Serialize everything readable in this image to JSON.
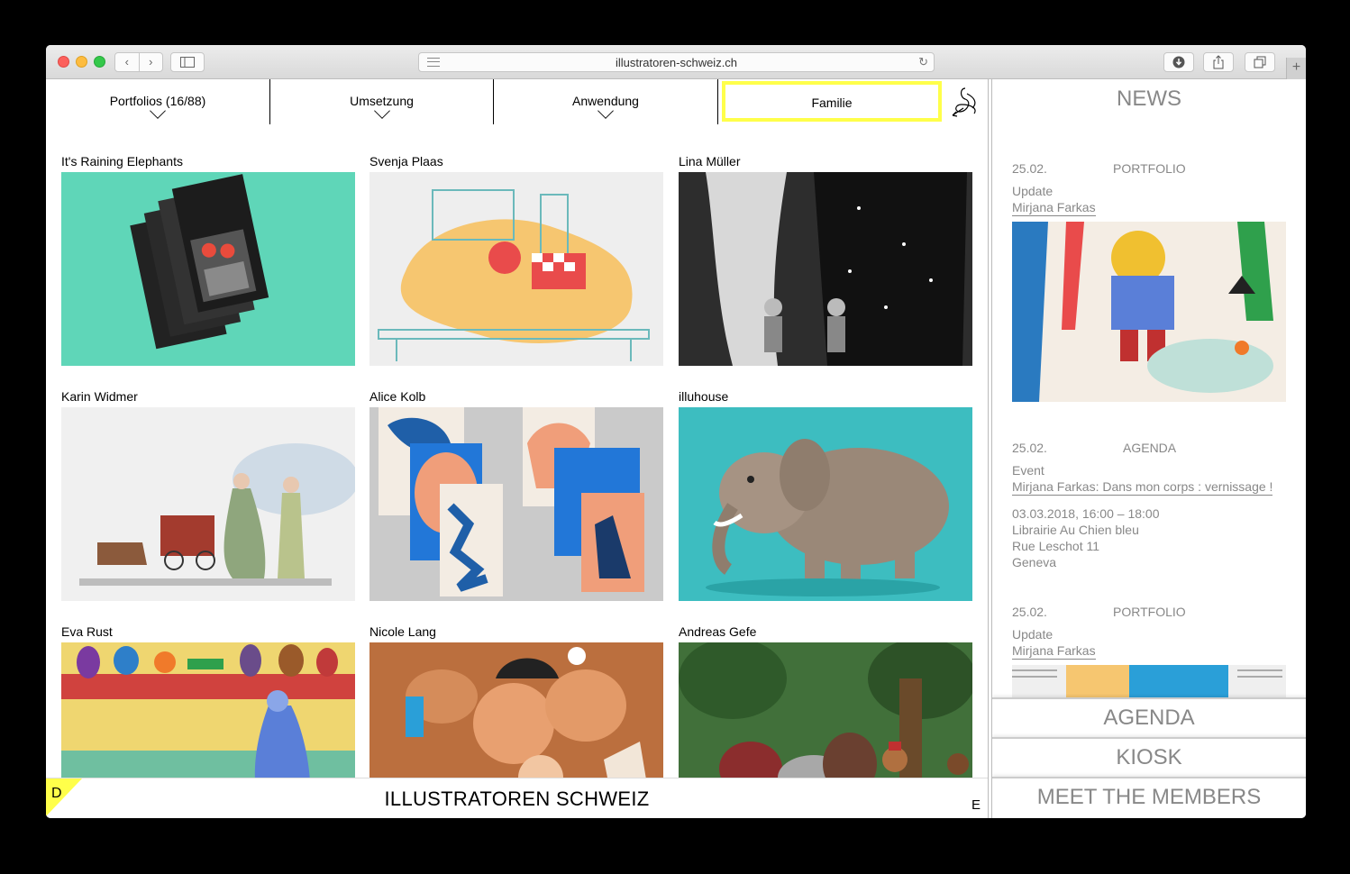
{
  "browser": {
    "url": "illustratoren-schweiz.ch",
    "back": "‹",
    "forward": "›",
    "reload": "↻",
    "newtab": "+"
  },
  "filters": {
    "portfolios": "Portfolios (16/88)",
    "umsetzung": "Umsetzung",
    "anwendung": "Anwendung",
    "familie": "Familie"
  },
  "grid": [
    {
      "name": "It's Raining Elephants"
    },
    {
      "name": "Svenja Plaas"
    },
    {
      "name": "Lina Müller"
    },
    {
      "name": "Karin Widmer"
    },
    {
      "name": "Alice Kolb"
    },
    {
      "name": "illuhouse"
    },
    {
      "name": "Eva Rust"
    },
    {
      "name": "Nicole Lang"
    },
    {
      "name": "Andreas Gefe"
    }
  ],
  "bottom": {
    "lang_d": "D",
    "title": "ILLUSTRATOREN SCHWEIZ",
    "lang_e": "E"
  },
  "news": {
    "heading": "NEWS",
    "entries": [
      {
        "date": "25.02.",
        "category": "PORTFOLIO",
        "kind": "Update",
        "link": "Mirjana Farkas"
      },
      {
        "date": "25.02.",
        "category": "AGENDA",
        "kind": "Event",
        "link": "Mirjana Farkas: Dans mon corps : vernissage !",
        "details": [
          "03.03.2018, 16:00 – 18:00",
          "Librairie Au Chien bleu",
          "Rue Leschot 11",
          "Geneva"
        ]
      },
      {
        "date": "25.02.",
        "category": "PORTFOLIO",
        "kind": "Update",
        "link": "Mirjana Farkas"
      }
    ],
    "tabs": {
      "agenda": "AGENDA",
      "kiosk": "KIOSK",
      "members": "MEET THE MEMBERS"
    }
  },
  "colors": {
    "highlight": "#ffff4a",
    "news_text": "#888888"
  }
}
